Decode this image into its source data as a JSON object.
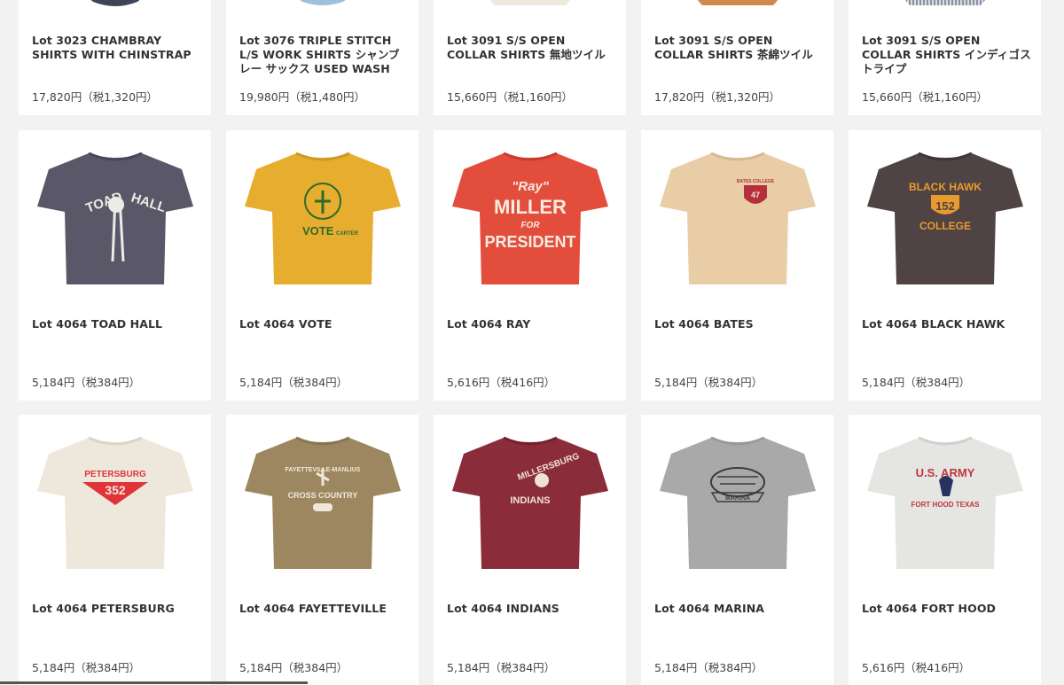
{
  "products": [
    {
      "title": "Lot 3023 CHAMBRAY SHIRTS WITH CHINSTRAP",
      "price": "17,820円（税1,320円）",
      "color": "#3d4656"
    },
    {
      "title": "Lot 3076 TRIPLE STITCH L/S WORK SHIRTS シャンブレー サックス USED WASH",
      "price": "19,980円（税1,480円）",
      "color": "#9fc0dd"
    },
    {
      "title": "Lot 3091 S/S OPEN COLLAR SHIRTS 無地ツイル",
      "price": "15,660円（税1,160円）",
      "color": "#eee9dc"
    },
    {
      "title": "Lot 3091 S/S OPEN COLLAR SHIRTS 茶綿ツイル",
      "price": "17,820円（税1,320円）",
      "color": "#d08a4c"
    },
    {
      "title": "Lot 3091 S/S OPEN COLLAR SHIRTS インディゴストライプ",
      "price": "15,660円（税1,160円）",
      "color": "#b7bcc6"
    },
    {
      "title": "Lot 4064 TOAD HALL",
      "price": "5,184円（税384円）",
      "color": "#5a5868",
      "print": "#ecebe6",
      "graphic": [
        "TOAD",
        "HALL"
      ]
    },
    {
      "title": "Lot 4064 VOTE",
      "price": "5,184円（税384円）",
      "color": "#e7ad2f",
      "print": "#2f6a2c",
      "graphic": [
        "VOTE",
        "CARTER"
      ]
    },
    {
      "title": "Lot 4064 RAY",
      "price": "5,616円（税416円）",
      "color": "#e34d3c",
      "print": "#f6ece1",
      "graphic": [
        "\"Ray\"",
        "MILLER",
        "FOR",
        "PRESIDENT"
      ]
    },
    {
      "title": "Lot 4064 BATES",
      "price": "5,184円（税384円）",
      "color": "#e8cda6",
      "print": "#b5303b",
      "graphic": [
        "BATES COLLEGE",
        "47"
      ]
    },
    {
      "title": "Lot 4064 BLACK HAWK",
      "price": "5,184円（税384円）",
      "color": "#4f4443",
      "print": "#e89a2e",
      "graphic": [
        "BLACK HAWK",
        "152",
        "COLLEGE"
      ]
    },
    {
      "title": "Lot 4064 PETERSBURG",
      "price": "5,184円（税384円）",
      "color": "#eee8dc",
      "print": "#e0343a",
      "graphic": [
        "PETERSBURG",
        "352"
      ]
    },
    {
      "title": "Lot 4064 FAYETTEVILLE",
      "price": "5,184円（税384円）",
      "color": "#9d8760",
      "print": "#efe8da",
      "graphic": [
        "FAYETTEVILLE-MANLIUS",
        "CROSS COUNTRY"
      ]
    },
    {
      "title": "Lot 4064 INDIANS",
      "price": "5,184円（税384円）",
      "color": "#8a2c3a",
      "print": "#efe2d6",
      "graphic": [
        "MILLERSBURG",
        "INDIANS"
      ]
    },
    {
      "title": "Lot 4064 MARINA",
      "price": "5,184円（税384円）",
      "color": "#a9a9a9",
      "print": "#3b3b3b",
      "graphic": [
        "MARINA"
      ]
    },
    {
      "title": "Lot 4064 FORT HOOD",
      "price": "5,616円（税416円）",
      "color": "#e5e5e2",
      "print": "#c0353c",
      "print2": "#26345d",
      "graphic": [
        "U.S. ARMY",
        "FORT HOOD TEXAS"
      ]
    }
  ]
}
